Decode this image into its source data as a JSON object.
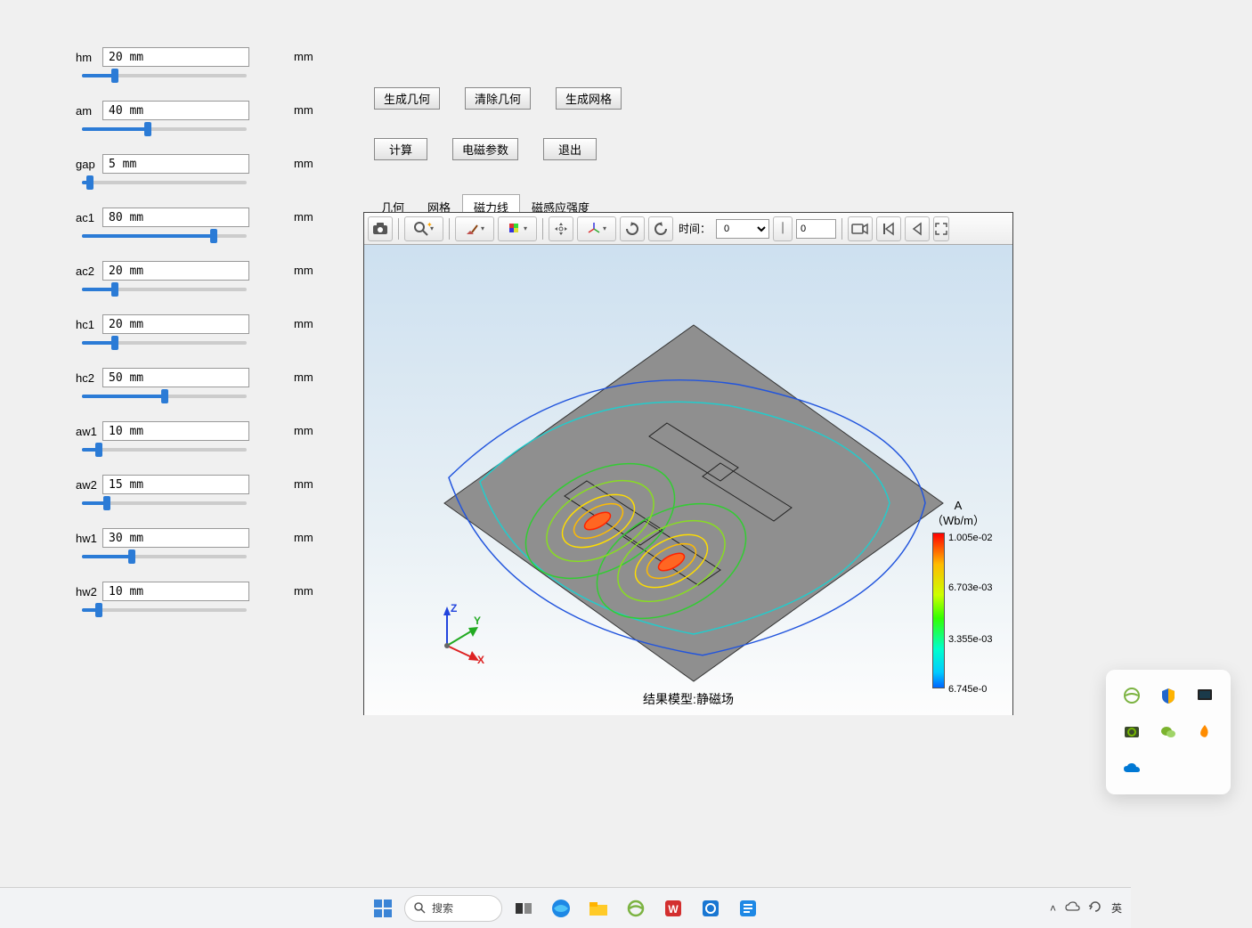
{
  "params": [
    {
      "name": "hm",
      "value": "20 mm",
      "unit": "mm",
      "sliderPct": 20
    },
    {
      "name": "am",
      "value": "40 mm",
      "unit": "mm",
      "sliderPct": 40
    },
    {
      "name": "gap",
      "value": "5 mm",
      "unit": "mm",
      "sliderPct": 5
    },
    {
      "name": "ac1",
      "value": "80 mm",
      "unit": "mm",
      "sliderPct": 80
    },
    {
      "name": "ac2",
      "value": "20 mm",
      "unit": "mm",
      "sliderPct": 20
    },
    {
      "name": "hc1",
      "value": "20 mm",
      "unit": "mm",
      "sliderPct": 20
    },
    {
      "name": "hc2",
      "value": "50 mm",
      "unit": "mm",
      "sliderPct": 50
    },
    {
      "name": "aw1",
      "value": "10 mm",
      "unit": "mm",
      "sliderPct": 10
    },
    {
      "name": "aw2",
      "value": "15 mm",
      "unit": "mm",
      "sliderPct": 15
    },
    {
      "name": "hw1",
      "value": "30 mm",
      "unit": "mm",
      "sliderPct": 30
    },
    {
      "name": "hw2",
      "value": "10 mm",
      "unit": "mm",
      "sliderPct": 10
    }
  ],
  "buttons": {
    "gen_geom": "生成几何",
    "clear_geom": "清除几何",
    "gen_mesh": "生成网格",
    "compute": "计算",
    "em_params": "电磁参数",
    "exit": "退出"
  },
  "tabs": {
    "geometry": "几何",
    "mesh": "网格",
    "flux_lines": "磁力线",
    "flux_density": "磁感应强度"
  },
  "active_tab": "flux_lines",
  "toolbar": {
    "time_label": "时间：",
    "time_value": "0",
    "step_value": "0"
  },
  "legend": {
    "title_line1": "A",
    "title_line2": "（Wb/m）",
    "ticks": [
      "1.005e-02",
      "6.703e-03",
      "3.355e-03",
      "6.745e-0"
    ]
  },
  "plot_caption": "结果模型:静磁场",
  "taskbar": {
    "search_placeholder": "搜索",
    "ime": "英"
  },
  "tray_icons": [
    "edge-ie",
    "shield",
    "monitor",
    "nvidia",
    "wechat",
    "flame",
    "onedrive"
  ],
  "chart_data": {
    "type": "contour",
    "title": "结果模型:静磁场",
    "quantity": "A (Wb/m)",
    "colorbar_range": [
      6.745e-06,
      0.01005
    ],
    "colorbar_ticks": [
      0.01005,
      0.006703,
      0.003355,
      6.745e-06
    ],
    "projection": "isometric-3d",
    "axes": [
      "X",
      "Y",
      "Z"
    ]
  }
}
